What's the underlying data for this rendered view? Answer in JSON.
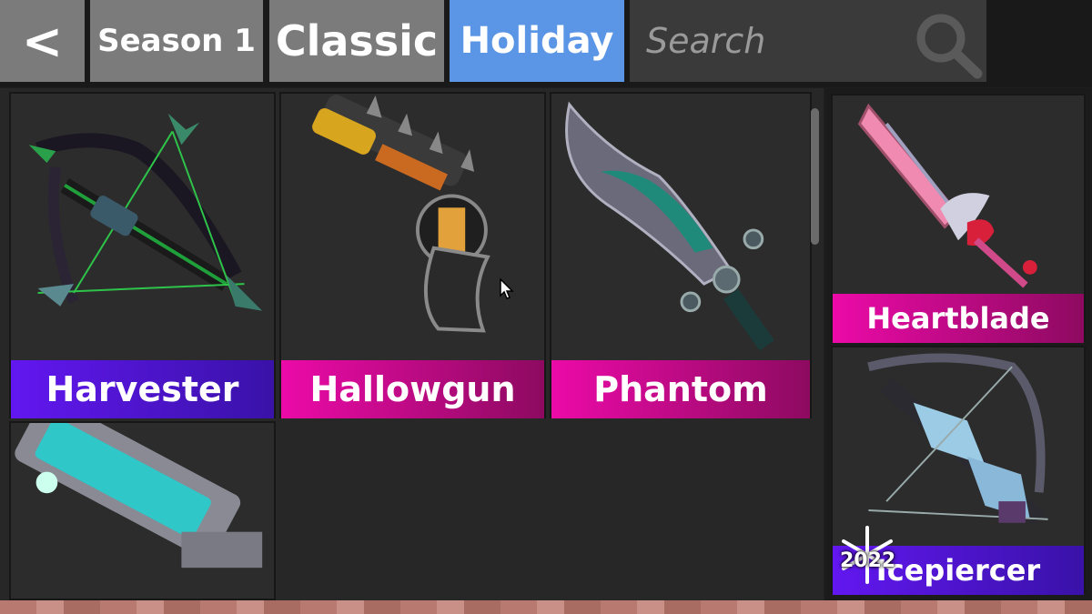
{
  "nav": {
    "back_label": "<",
    "tabs": [
      {
        "label": "Season 1"
      },
      {
        "label": "Classic"
      },
      {
        "label": "Holiday",
        "active": true
      }
    ],
    "search": {
      "placeholder": "Search",
      "value": ""
    }
  },
  "grid": {
    "items": [
      {
        "name": "Harvester",
        "rarity_color": "#5a16e0"
      },
      {
        "name": "Hallowgun",
        "rarity_color": "#e10ca0"
      },
      {
        "name": "Phantom",
        "rarity_color": "#e10ca0"
      },
      {
        "name": "",
        "rarity_color": ""
      }
    ]
  },
  "side": {
    "items": [
      {
        "name": "Heartblade",
        "rarity_color": "#e10ca0"
      },
      {
        "name": "Icepiercer",
        "rarity_color": "#5a16e0",
        "badge": "2022"
      }
    ]
  },
  "colors": {
    "active_tab": "#5b95e6",
    "inactive_tab": "#7b7b7b",
    "godly": "#e10ca0",
    "ancient": "#5a16e0"
  }
}
